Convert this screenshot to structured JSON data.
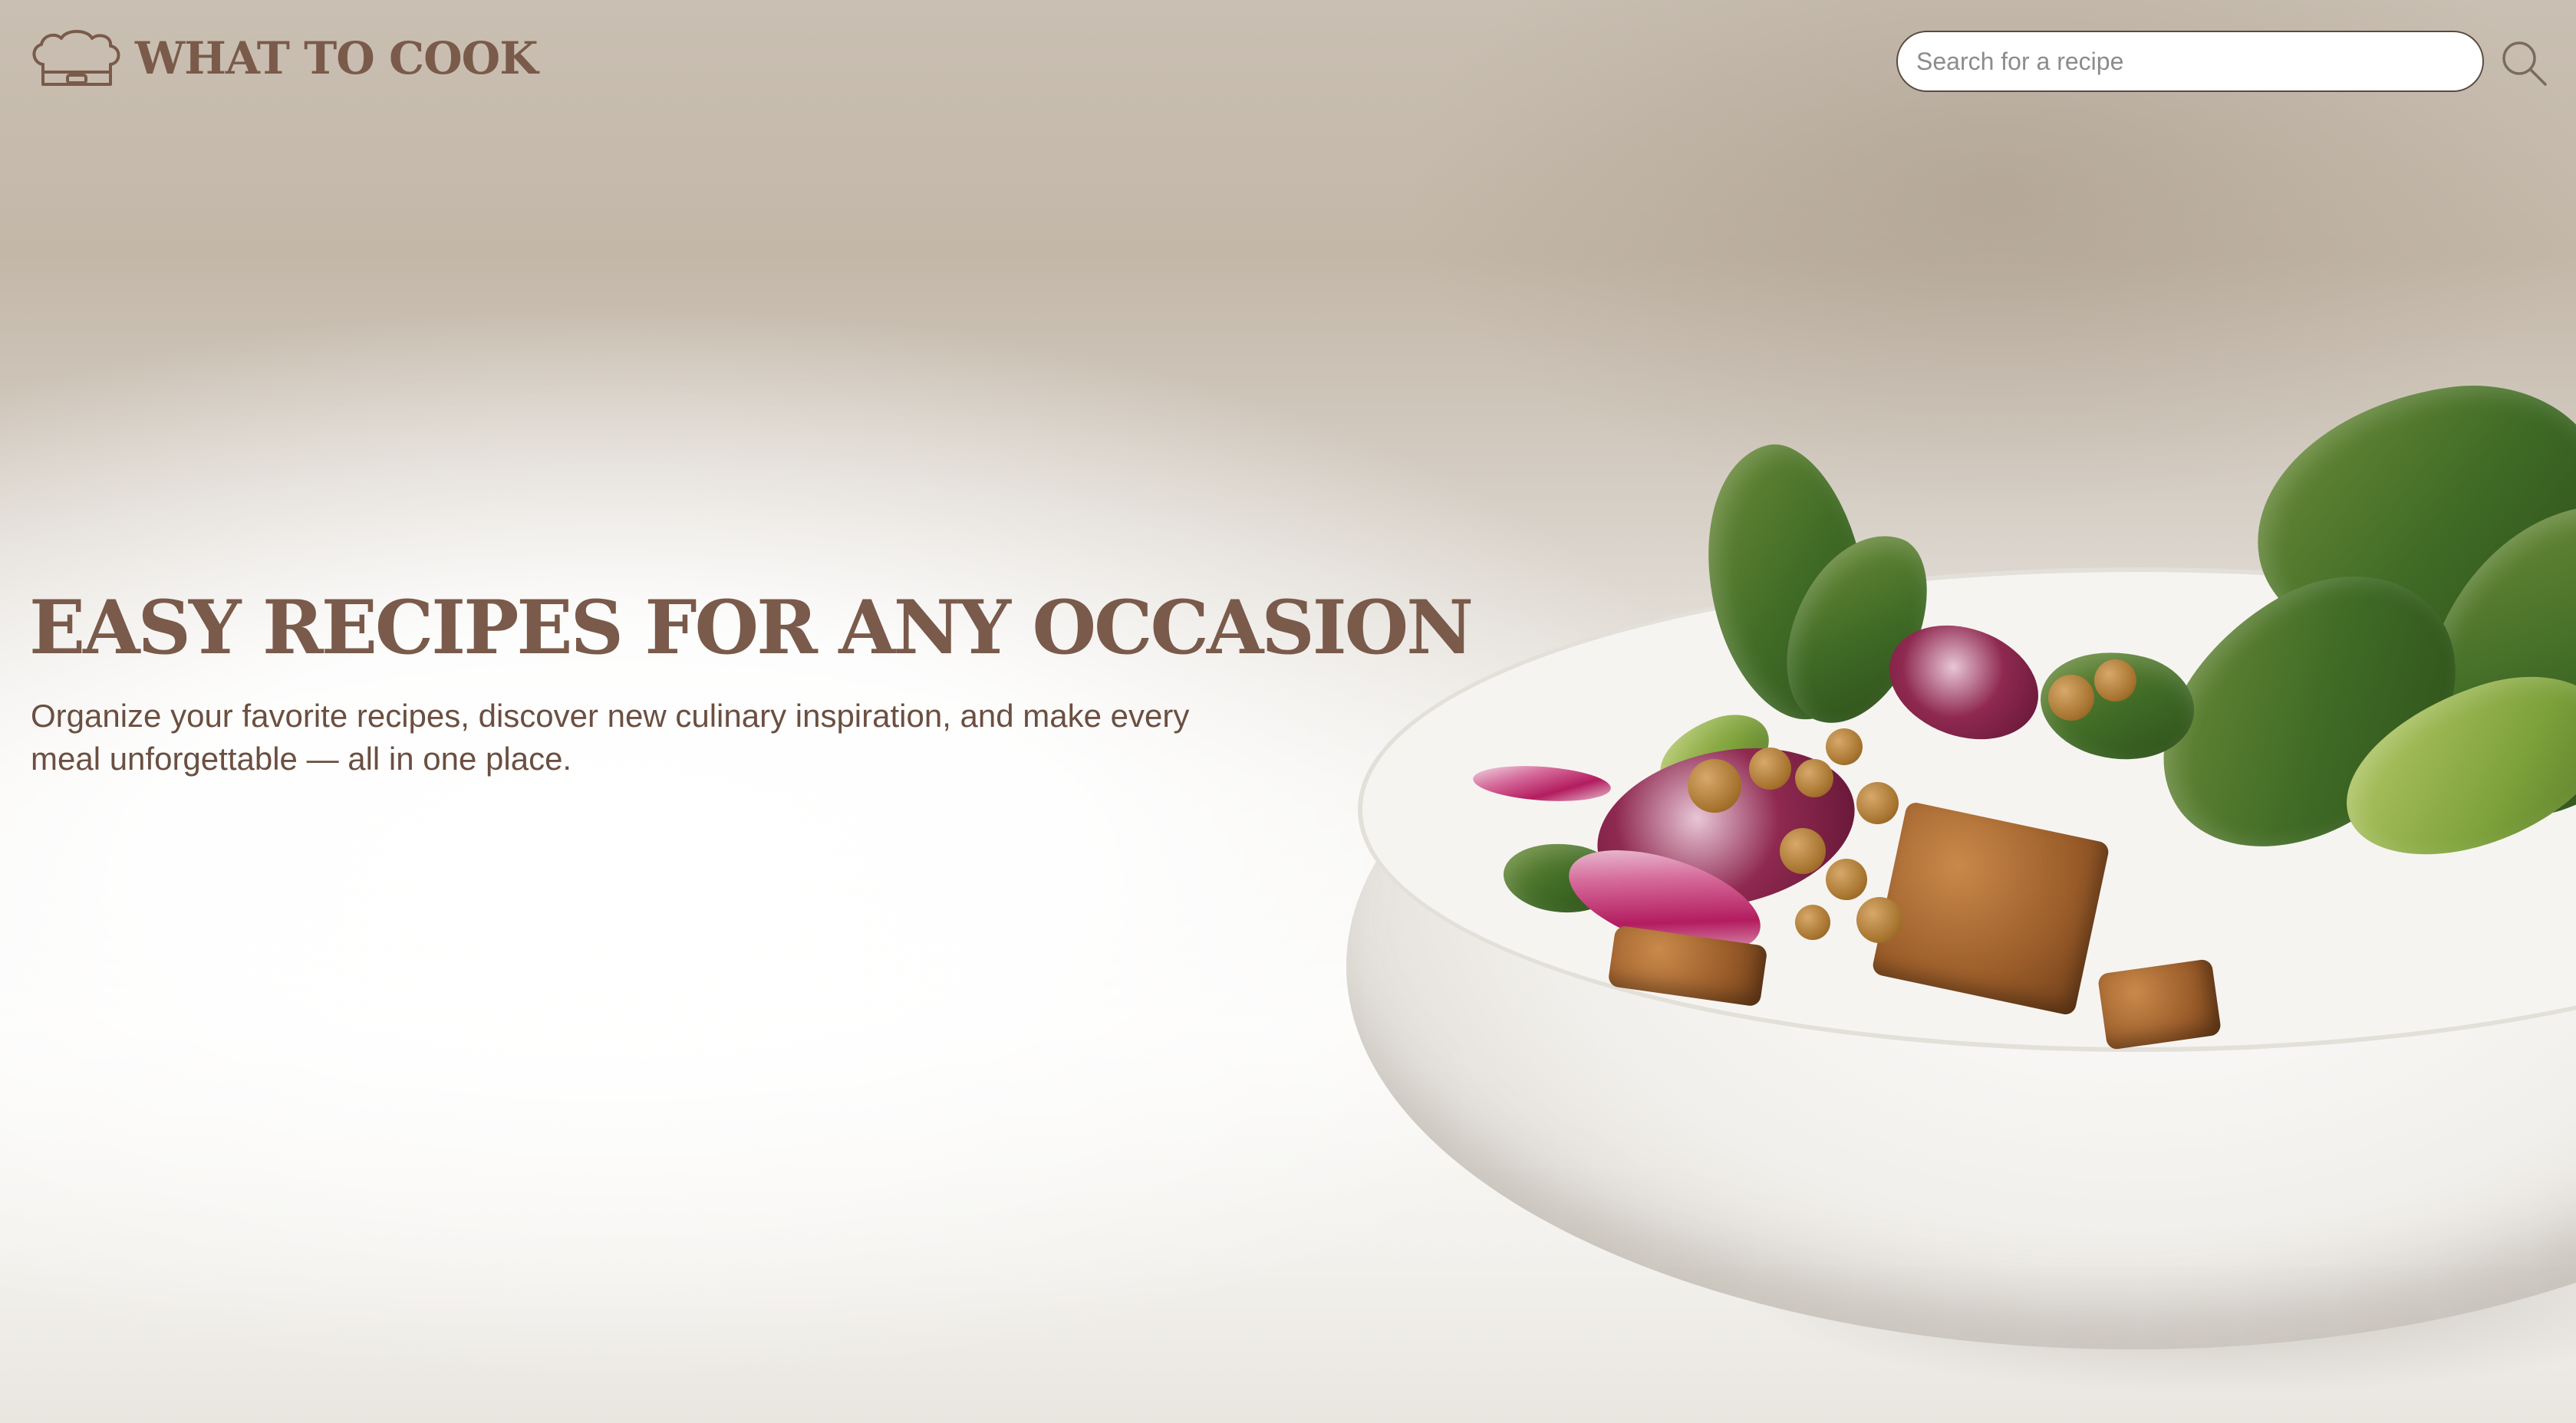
{
  "header": {
    "brand_name": "WHAT TO COOK",
    "brand_icon": "chef-hat-icon",
    "search": {
      "placeholder": "Search for a recipe",
      "value": "",
      "button_icon": "search-icon"
    }
  },
  "hero": {
    "title": "EASY RECIPES FOR ANY OCCASION",
    "subtitle": "Organize your favorite recipes, discover new culinary inspiration, and make every meal unforgettable — all in one place.",
    "image_subject": "salad bowl"
  },
  "colors": {
    "brand": "#7a5a4a",
    "text_secondary": "#6b4f41",
    "search_border": "#5b4a40",
    "background": "#ffffff"
  }
}
